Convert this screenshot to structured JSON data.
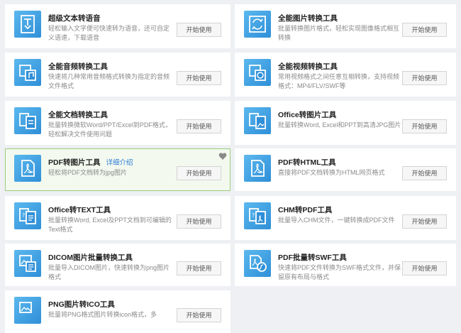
{
  "tools": [
    {
      "title": "超级文本转语音",
      "desc": "轻松输入文字便可快速转为语音，还可自定义语速，下载语音",
      "button": "开始使用",
      "icon": "text-to-speech-icon"
    },
    {
      "title": "全能图片转换工具",
      "desc": "批量转换图片格式，轻松实现图像格式相互转换",
      "button": "开始使用",
      "icon": "image-convert-icon"
    },
    {
      "title": "全能音频转换工具",
      "desc": "快速将几种常用音频格式转换为指定的音频文件格式",
      "button": "开始使用",
      "icon": "audio-convert-icon"
    },
    {
      "title": "全能视频转换工具",
      "desc": "常用视频格式之间任意互相转换，支持视频格式：MP4/FLV/SWF等",
      "button": "开始使用",
      "icon": "video-convert-icon"
    },
    {
      "title": "全能文档转换工具",
      "desc": "批量转换微软Word/PPT/Excel到PDF格式，轻松解决文件使用问题",
      "button": "开始使用",
      "icon": "document-convert-icon"
    },
    {
      "title": "Office转图片工具",
      "desc": "批量转换Word, Excel和PPT到高清JPG图片",
      "button": "开始使用",
      "icon": "office-to-image-icon"
    },
    {
      "title": "PDF转图片工具",
      "link": "详细介绍",
      "desc": "轻松将PDF文档转为jpg图片",
      "button": "开始使用",
      "icon": "pdf-to-image-icon"
    },
    {
      "title": "PDF转HTML工具",
      "desc": "直接将PDF文档转换为HTML网页格式",
      "button": "开始使用",
      "icon": "pdf-to-html-icon"
    },
    {
      "title": "Office转TEXT工具",
      "desc": "批量转换Word, Excel及PPT文档到可编辑的Text格式",
      "button": "开始使用",
      "icon": "office-to-text-icon"
    },
    {
      "title": "CHM转PDF工具",
      "desc": "批量导入CHM文件，一键转换成PDF文件",
      "button": "开始使用",
      "icon": "chm-to-pdf-icon"
    },
    {
      "title": "DICOM图片批量转换工具",
      "desc": "批量导入DICOM图片，快速转换为png图片格式",
      "button": "开始使用",
      "icon": "dicom-convert-icon"
    },
    {
      "title": "PDF批量转SWF工具",
      "desc": "快速将PDF文件转换为SWF格式文件，并保留原有布局与格式",
      "button": "开始使用",
      "icon": "pdf-to-swf-icon"
    },
    {
      "title": "PNG图片转ICO工具",
      "desc": "批量将PNG格式图片转换icon格式，多",
      "button": "开始使用",
      "icon": "png-to-ico-icon"
    }
  ],
  "colors": {
    "accent": "#2f8fd8",
    "selected_border": "#9ccc7e",
    "link": "#2b7bd6"
  }
}
